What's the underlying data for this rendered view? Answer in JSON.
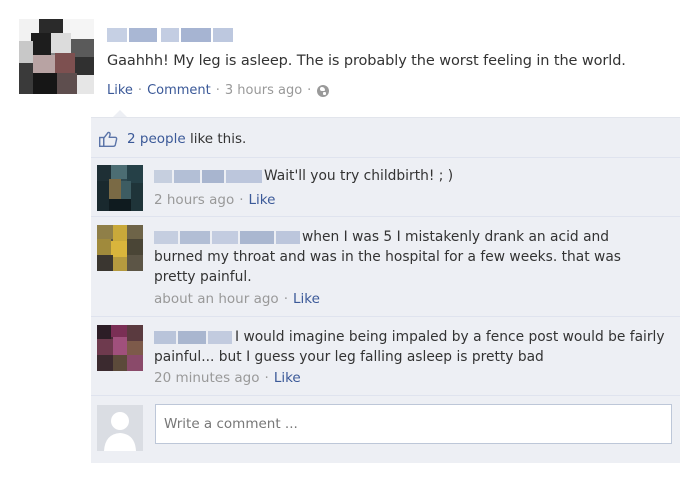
{
  "post": {
    "author_name": "",
    "text": "Gaahhh! My leg is asleep. The is probably the worst feeling in the world.",
    "actions": {
      "like": "Like",
      "comment": "Comment"
    },
    "separator": "·",
    "timestamp": "3 hours ago",
    "privacy_icon": "globe-icon"
  },
  "likes": {
    "icon": "thumbs-up-icon",
    "count_text": "2 people",
    "suffix": "like this."
  },
  "comments": [
    {
      "author_name": "",
      "lines": [
        "Wait'll you try childbirth! ; )"
      ],
      "timestamp": "2 hours ago",
      "like": "Like"
    },
    {
      "author_name": "",
      "lines": [
        "when I was 5 I mistakenly drank an acid and",
        "burned my throat and was in the hospital for a few weeks. that was",
        "pretty painful."
      ],
      "timestamp": "about an hour ago",
      "like": "Like"
    },
    {
      "author_name": "",
      "lines": [
        "I would imagine being impaled by a fence post would be fairly",
        "painful... but I guess your leg falling asleep is pretty bad"
      ],
      "timestamp": "20 minutes ago",
      "like": "Like"
    }
  ],
  "compose": {
    "placeholder": "Write a comment ...",
    "avatar_icon": "default-user-silhouette-icon"
  },
  "colors": {
    "link": "#3b5998",
    "muted": "#999999",
    "text": "#333333",
    "ufi_background": "#edeff4",
    "divider": "#dfe3ee",
    "input_border": "#bdc7d8"
  }
}
